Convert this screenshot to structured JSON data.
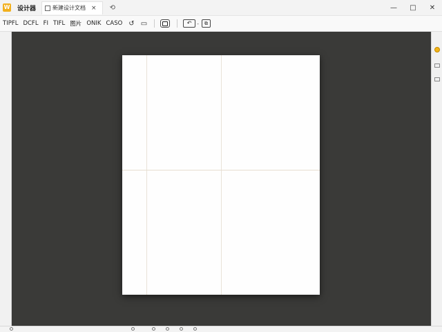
{
  "app": {
    "title": "设计器",
    "icon_label": "W",
    "accent": "#f2b01e"
  },
  "document_tab": {
    "label": "新建设计文档",
    "close": "×",
    "new_tab": "⟲"
  },
  "window_controls": {
    "minimize": "—",
    "maximize": "□",
    "close": "✕"
  },
  "toolbar": {
    "menu_items": [
      "TIPFL",
      "DCFL",
      "FI",
      "TIFL",
      "图片",
      "ONIK",
      "CASO"
    ]
  },
  "page": {
    "background": "#fefefe"
  }
}
